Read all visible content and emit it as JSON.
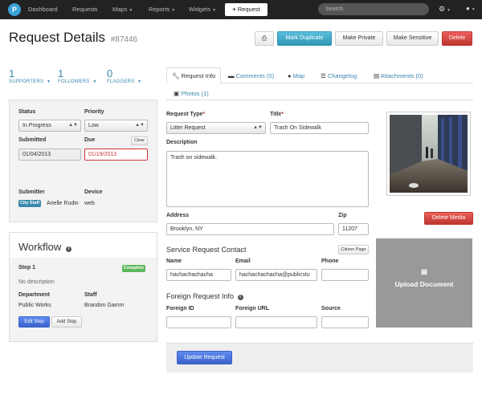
{
  "nav": {
    "logo": "P",
    "dashboard": "Dashboard",
    "requests": "Requests",
    "maps": "Maps",
    "reports": "Reports",
    "widgets": "Widgets",
    "new_request": "Request",
    "search_placeholder": "Search",
    "settings_icon": "gear-icon",
    "user_icon": "user-icon"
  },
  "header": {
    "title": "Request Details",
    "id": "#87446",
    "print_icon": "print-icon",
    "mark_duplicate": "Mark Duplicate",
    "make_private": "Make Private",
    "make_sensitive": "Make Sensitive",
    "delete": "Delete"
  },
  "stats": [
    {
      "count": "1",
      "label": "SUPPORTERS"
    },
    {
      "count": "1",
      "label": "FOLLOWERS"
    },
    {
      "count": "0",
      "label": "FLAGGERS"
    }
  ],
  "details": {
    "status_label": "Status",
    "status_value": "In Progress",
    "priority_label": "Priority",
    "priority_value": "Low",
    "submitted_label": "Submitted",
    "submitted_value": "01/04/2013",
    "due_label": "Due",
    "due_value": "01/19/2013",
    "clear": "Clear",
    "submitter_label": "Submitter",
    "submitter_badge": "City Staff",
    "submitter_name": "Arielle Rudin",
    "device_label": "Device",
    "device_value": "web"
  },
  "workflow": {
    "title": "Workflow",
    "step": "Step 1",
    "status": "Complete",
    "description": "No description",
    "department_label": "Department",
    "department_value": "Public Works",
    "staff_label": "Staff",
    "staff_value": "Brandon Gamm",
    "edit_step": "Edit Step",
    "add_step": "Add Step"
  },
  "tabs": {
    "request_info": "Request Info",
    "comments": "Comments (0)",
    "map": "Map",
    "changelog": "Changelog",
    "attachments": "Attachments (0)",
    "photos": "Photos (1)"
  },
  "form": {
    "request_type_label": "Request Type",
    "required_mark": "*",
    "request_type_value": "Litter Request",
    "title_label": "Title",
    "title_value": "Trash On Sidewalk",
    "description_label": "Description",
    "description_value": "Trash on sidewalk.",
    "address_label": "Address",
    "address_value": "Brooklyn, NY",
    "zip_label": "Zip",
    "zip_value": "11207",
    "contact_header": "Service Request Contact",
    "citizen_page": "Citizen Page",
    "name_label": "Name",
    "name_value": "hachachachacha",
    "email_label": "Email",
    "email_value": "hachachachacha@publicstu",
    "phone_label": "Phone",
    "phone_value": "",
    "foreign_header": "Foreign Request Info",
    "foreign_id_label": "Foreign ID",
    "foreign_url_label": "Foreign URL",
    "source_label": "Source",
    "update": "Update Request"
  },
  "media": {
    "delete_media": "Delete Media",
    "upload_document": "Upload Document"
  },
  "colors": {
    "accent": "#3a87ad",
    "danger": "#bd362f",
    "info": "#2f96b4",
    "primary": "#3a62c9",
    "success": "#62c462"
  }
}
